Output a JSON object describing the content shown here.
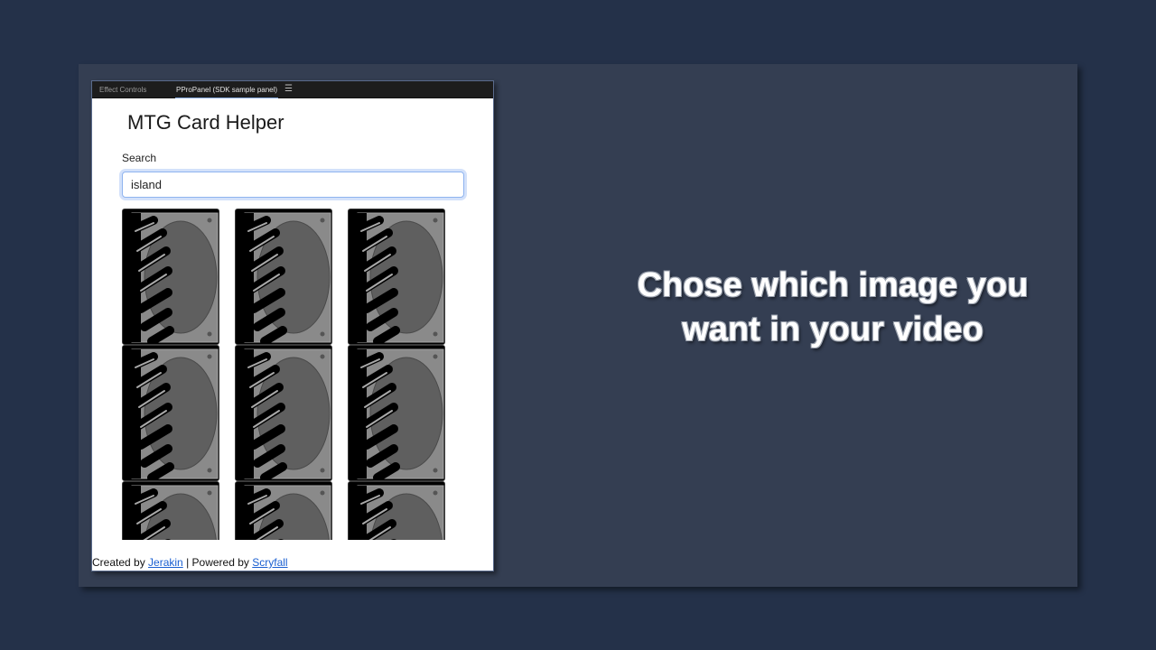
{
  "panel": {
    "tabs": [
      {
        "label": "Effect Controls"
      },
      {
        "label": "PProPanel (SDK sample panel)"
      }
    ],
    "menu_icon": "hamburger-menu-icon"
  },
  "app": {
    "title": "MTG Card Helper",
    "search": {
      "label": "Search",
      "value": "island"
    },
    "results": {
      "card_icon": "card-image-placeholder-icon",
      "visible_card_count": 9
    },
    "footer": {
      "created_prefix": "Created by",
      "author_link": "Jerakin",
      "separator": "| Powered by",
      "powered_link": "Scryfall"
    }
  },
  "caption": {
    "line1": "Chose which image you",
    "line2": "want in your video"
  },
  "colors": {
    "background": "#243149",
    "slide": "#343e52",
    "link": "#1a5fd1"
  }
}
